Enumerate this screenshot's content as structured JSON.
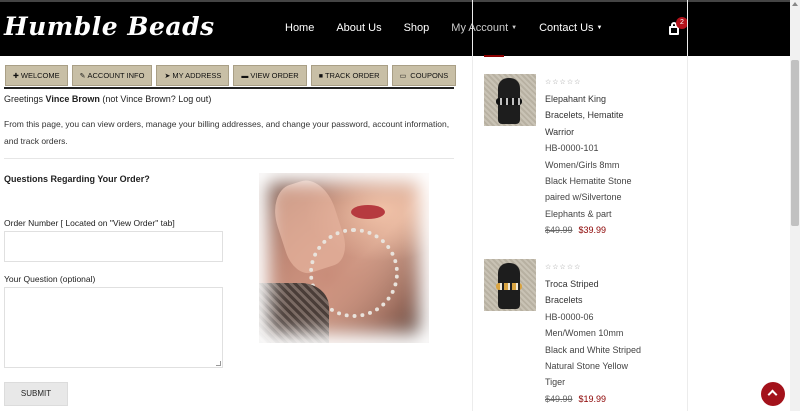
{
  "brand": {
    "logo_text": "Humble Beads"
  },
  "nav": {
    "home": "Home",
    "about": "About Us",
    "shop": "Shop",
    "account": "My Account",
    "contact": "Contact Us",
    "cart_count": "2"
  },
  "tabs": [
    {
      "label": "WELCOME",
      "icon": "plus-icon"
    },
    {
      "label": "ACCOUNT INFO",
      "icon": "edit-icon"
    },
    {
      "label": "MY ADDRESS",
      "icon": "location-arrow-icon"
    },
    {
      "label": "VIEW ORDER",
      "icon": "cart-icon"
    },
    {
      "label": "TRACK ORDER",
      "icon": "truck-icon"
    },
    {
      "label": "COUPONS",
      "icon": "ticket-icon"
    }
  ],
  "greeting": {
    "prefix": "Greetings ",
    "user": "Vince Brown",
    "middle": " (not Vince Brown? ",
    "logout": "Log out",
    "suffix": ")"
  },
  "intro_text": "From this page, you can view orders, manage your billing addresses, and change your password, account information, and track orders.",
  "form": {
    "heading": "Questions Regarding Your Order?",
    "order_label": "Order Number [ Located on \"View Order\" tab]",
    "order_value": "",
    "question_label": "Your Question (optional)",
    "question_value": "",
    "submit_label": "SUBMIT"
  },
  "products": [
    {
      "stars": "☆☆☆☆☆",
      "name_lines": [
        "Elepahant King",
        "Bracelets, Hematite",
        "Warrior"
      ],
      "sku": "HB-0000-101",
      "desc_lines": [
        "Women/Girls 8mm",
        "Black Hematite Stone",
        "paired w/Silvertone",
        "Elephants & part"
      ],
      "old_price": "$49.99",
      "new_price": "$39.99"
    },
    {
      "stars": "☆☆☆☆☆",
      "name_lines": [
        "Troca Striped",
        "Bracelets"
      ],
      "sku": "HB-0000-06",
      "desc_lines": [
        "Men/Women 10mm",
        "Black and White Striped",
        "Natural Stone Yellow",
        "Tiger"
      ],
      "old_price": "$49.99",
      "new_price": "$19.99"
    }
  ],
  "colors": {
    "header_bg": "#000000",
    "tab_bg": "#c8bfa6",
    "accent": "#8b0000",
    "totop": "#a3121b"
  }
}
